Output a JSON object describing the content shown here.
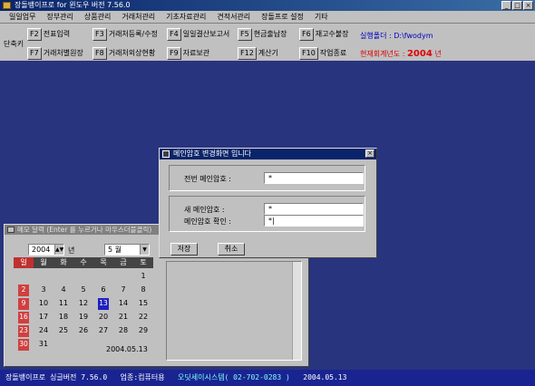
{
  "window": {
    "title": "장돌뱅이프로 for 윈도우 버전 7.56.0",
    "buttons": [
      "_",
      "□",
      "×"
    ]
  },
  "menubar": [
    "일일업무",
    "장부관리",
    "상품관리",
    "거래처관리",
    "기초자료관리",
    "견적서관리",
    "장돌프로 설정",
    "기타"
  ],
  "toolbar": {
    "label": "단축키",
    "row1": [
      {
        "key": "F2",
        "label": "전표입력"
      },
      {
        "key": "F3",
        "label": "거래처등록/수정"
      },
      {
        "key": "F4",
        "label": "일일결산보고서"
      },
      {
        "key": "F5",
        "label": "현금출납장"
      },
      {
        "key": "F6",
        "label": "재고수불장"
      }
    ],
    "row2": [
      {
        "key": "F7",
        "label": "거래처별원장"
      },
      {
        "key": "F8",
        "label": "거래처외상현황"
      },
      {
        "key": "F9",
        "label": "자료보관"
      },
      {
        "key": "F12",
        "label": "계산기"
      },
      {
        "key": "F10",
        "label": "작업종료"
      }
    ],
    "run_folder_label": "실행폴더 : D:\\fwodym",
    "fiscal_year_label": "현재회계년도 :",
    "fiscal_year": "2004",
    "fiscal_year_suffix": "년",
    "colors": {
      "run_folder": "#0000c0",
      "fiscal_year": "#e00000"
    }
  },
  "dialog": {
    "title": "메인암호 변경화면 입니다",
    "close": "×",
    "old_password_label": "전번 메인암호 :",
    "old_password_value": "*",
    "new_password_label": "새    메인암호 :",
    "new_password_value": "*",
    "confirm_label": "메인암호 확인 :",
    "confirm_value": "*|",
    "save_button": "저장",
    "cancel_button": "취소"
  },
  "memo": {
    "title": "메모 달력 (Enter 를 누르거나 마우스더블클릭)",
    "year": "2004",
    "year_suffix": "년",
    "month": "5 월",
    "weekdays": [
      "일",
      "월",
      "화",
      "수",
      "목",
      "금",
      "토"
    ],
    "days": [
      "",
      "",
      "",
      "",
      "",
      "",
      "1",
      "2",
      "3",
      "4",
      "5",
      "6",
      "7",
      "8",
      "9",
      "10",
      "11",
      "12",
      "13",
      "14",
      "15",
      "16",
      "17",
      "18",
      "19",
      "20",
      "21",
      "22",
      "23",
      "24",
      "25",
      "26",
      "27",
      "28",
      "29",
      "30",
      "31",
      "",
      "",
      "",
      "",
      ""
    ],
    "today": "13",
    "date_display": "2004.05.13",
    "colors": {
      "sunday": "#d04040",
      "today": "#2020c0"
    }
  },
  "statusbar": {
    "product": "장돌뱅이프로 싱글버전 7.56.0",
    "business": "업종:컴퓨터용",
    "company": "오딧세이시스템( 02-702-0283 )",
    "date": "2004.05.13",
    "colors": {
      "background": "#1a2490"
    }
  },
  "desktop": {
    "color": "#29347f"
  }
}
